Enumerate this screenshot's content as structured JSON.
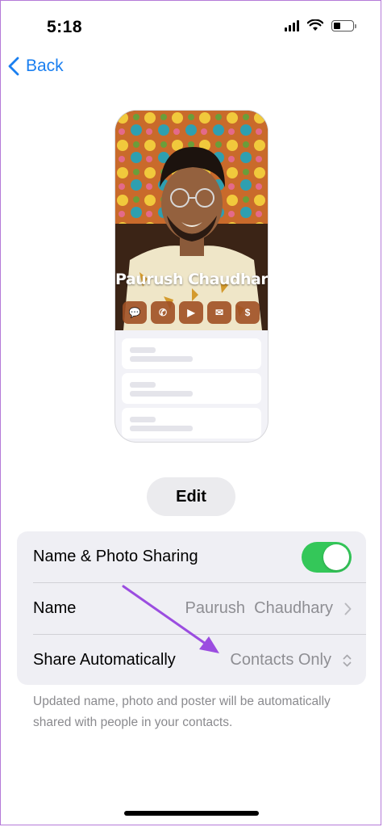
{
  "status": {
    "time": "5:18",
    "battery_level": 0.35
  },
  "nav": {
    "back_label": "Back"
  },
  "poster": {
    "name": "Paurush Chaudhary",
    "actions": [
      {
        "icon": "message-icon",
        "glyph": "💬"
      },
      {
        "icon": "phone-icon",
        "glyph": "✆"
      },
      {
        "icon": "video-icon",
        "glyph": "▶"
      },
      {
        "icon": "mail-icon",
        "glyph": "✉"
      },
      {
        "icon": "pay-icon",
        "glyph": "$"
      }
    ]
  },
  "edit": {
    "label": "Edit"
  },
  "settings": {
    "name_photo_sharing": {
      "label": "Name & Photo Sharing",
      "enabled": true
    },
    "name": {
      "label": "Name",
      "value": "Paurush  Chaudhary"
    },
    "share_automatically": {
      "label": "Share Automatically",
      "value": "Contacts Only"
    }
  },
  "footnote": "Updated name, photo and poster will be automatically shared with people in your contacts.",
  "colors": {
    "accent": "#1a7ff0",
    "toggle_on": "#34c759",
    "annotation": "#9b4de0"
  }
}
